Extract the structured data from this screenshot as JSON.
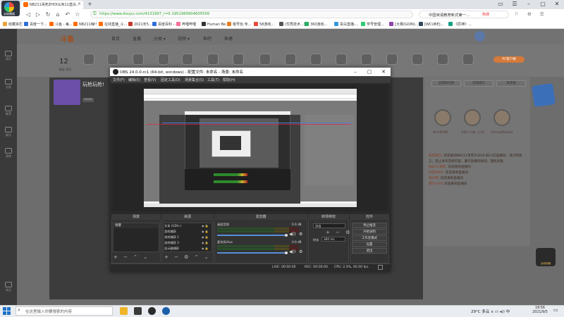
{
  "browser": {
    "logo_label": "云极播器",
    "tab_title": "NB211哥死ZHOULIN11直白...",
    "tab_close": "×",
    "tab_add": "+",
    "url": "https://www.douyu.com/4131997_r=0.1951989904605556",
    "search_text": "中国英语教育新式第一...",
    "search_hot": "热搜",
    "window_controls": [
      "▭",
      "☰",
      "–",
      "▢",
      "✕"
    ],
    "nav": [
      "◁",
      "▷",
      "↻",
      "⌂",
      "↶",
      "☆"
    ],
    "toolbar_icons": "⚐ ⚙ ☰",
    "bookmarks": [
      {
        "label": "收藏夹栏",
        "color": "#e8a23c"
      },
      {
        "label": "百度一下...",
        "color": "#2f6fd6"
      },
      {
        "label": "斗鱼 - 每...",
        "color": "#ff6a00"
      },
      {
        "label": "NB211嗨!!",
        "color": "#ff6a00"
      },
      {
        "label": "在线直播_斗...",
        "color": "#ff6a00"
      },
      {
        "label": "2021年5...",
        "color": "#c0392b"
      },
      {
        "label": "百度百科 -...",
        "color": "#2f6fd6"
      },
      {
        "label": "哔哩哔哩",
        "color": "#fb7299"
      },
      {
        "label": "Human Be...",
        "color": "#333333"
      },
      {
        "label": "租号玩-专...",
        "color": "#e67e22"
      },
      {
        "label": "58游戏...",
        "color": "#e74c3c"
      },
      {
        "label": "(优秀技术...)",
        "color": "#555555"
      },
      {
        "label": "360游戏...",
        "color": "#27ae60"
      },
      {
        "label": "青白直播-...",
        "color": "#3498db"
      },
      {
        "label": "学号管理...",
        "color": "#2ecc71"
      },
      {
        "label": "[大赛(GOIN)...",
        "color": "#8e44ad"
      },
      {
        "label": "[WCUBE]...",
        "color": "#34495e"
      },
      {
        "label": "《原神》...",
        "color": "#16a085"
      }
    ]
  },
  "douyu": {
    "leftbar": [
      "首页",
      "分类",
      "推荐",
      "娱乐",
      "游戏",
      "关注"
    ],
    "nav_links": [
      "首页",
      "直播",
      "分类 ▾",
      "视频 ▾",
      "鱼吧",
      "鱼塘"
    ],
    "follow_count": "12",
    "follow_label": "粉丝 关注",
    "pc_download": "PC客户端",
    "room_title": "玩枪玩枪!",
    "game_tag": "CS:GO",
    "right_tabs": [
      "全网排行榜",
      "日周排行",
      "贵宾榜"
    ],
    "fans": [
      "NineTailWE",
      "不是十六夜（小号）",
      "ChirrupMeGood"
    ],
    "chat": [
      {
        "name": "系统提示:",
        "text": "欢迎来到NB211哥死ZHOULIN11的直播间。请文明发言，禁止发布违规内容，遵守直播间规则，理性观看。"
      },
      {
        "name": "NB211哥死:",
        "text": "欢迎来到直播间"
      },
      {
        "name": "水友0001:",
        "text": "欢迎来到直播间"
      },
      {
        "name": "观众甲:",
        "text": "欢迎来到直播间"
      },
      {
        "name": "用户1101",
        "text": "欢迎来到直播间"
      }
    ],
    "mascot_label": "活动攻略"
  },
  "obs": {
    "title": "OBS 24.0.0-rc1 (64-bit, windows) - 配置文件: 未命名 - 场景: 未命名",
    "window_controls": [
      "–",
      "▢",
      "✕"
    ],
    "menu": [
      "文件(F)",
      "编辑(E)",
      "查看(V)",
      "固定工具(D)",
      "场景集合(S)",
      "工具(T)",
      "帮助(H)"
    ],
    "docks": {
      "scenes_title": "场景",
      "sources_title": "来源",
      "mixer_title": "混音器",
      "transitions_title": "转场特效",
      "controls_title": "控件"
    },
    "scene_item": "场景",
    "sources": [
      "文本 (GDI+)",
      "游戏捕获",
      "游戏捕获 2",
      "游戏捕获 3",
      "显示器捕获"
    ],
    "mixer": [
      {
        "name": "桌面音频",
        "db": "0.0 dB"
      },
      {
        "name": "麦克风/Aux",
        "db": "0.0 dB"
      }
    ],
    "transition_select": "淡出",
    "duration_label": "时长",
    "duration_value": "300 ms",
    "list_buttons": "+ − ⌃ ⌄",
    "source_buttons": "+ − ⚙ ⌃ ⌄",
    "transition_buttons": "+ − ⚙",
    "controls": [
      "停止推流",
      "开始录制",
      "工作室模式",
      "设置",
      "退出"
    ],
    "status": {
      "live": "LIVE: 00:00:00",
      "rec": "REC: 00:00:00",
      "cpu": "CPU: 2.0%, 60.00 fps"
    }
  },
  "taskbar": {
    "search_placeholder": "在这里输入你要搜索的内容",
    "search_icon": "⌕",
    "apps": [
      "#f0b429",
      "#3a3a3a",
      "#2b2b2b",
      "#1b5fa8"
    ],
    "tray_text": "29°C 多云  ∧  ▭  ◂)) 中",
    "time": "19:56",
    "date": "2021/9/5"
  }
}
